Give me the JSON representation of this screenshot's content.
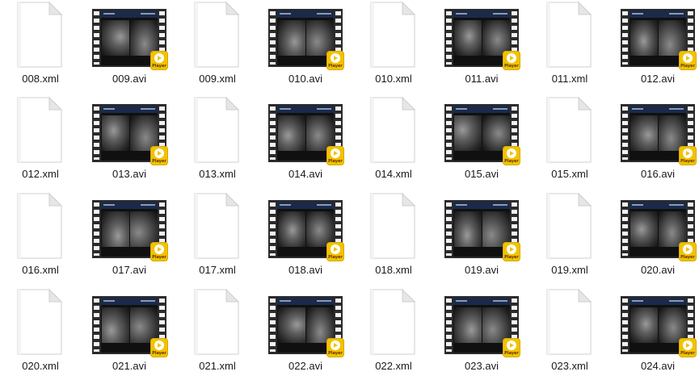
{
  "files": [
    {
      "name": "008.xml",
      "type": "xml"
    },
    {
      "name": "009.avi",
      "type": "avi"
    },
    {
      "name": "009.xml",
      "type": "xml"
    },
    {
      "name": "010.avi",
      "type": "avi"
    },
    {
      "name": "010.xml",
      "type": "xml"
    },
    {
      "name": "011.avi",
      "type": "avi"
    },
    {
      "name": "011.xml",
      "type": "xml"
    },
    {
      "name": "012.avi",
      "type": "avi"
    },
    {
      "name": "012.xml",
      "type": "xml"
    },
    {
      "name": "013.avi",
      "type": "avi"
    },
    {
      "name": "013.xml",
      "type": "xml"
    },
    {
      "name": "014.avi",
      "type": "avi"
    },
    {
      "name": "014.xml",
      "type": "xml"
    },
    {
      "name": "015.avi",
      "type": "avi"
    },
    {
      "name": "015.xml",
      "type": "xml"
    },
    {
      "name": "016.avi",
      "type": "avi"
    },
    {
      "name": "016.xml",
      "type": "xml"
    },
    {
      "name": "017.avi",
      "type": "avi"
    },
    {
      "name": "017.xml",
      "type": "xml"
    },
    {
      "name": "018.avi",
      "type": "avi"
    },
    {
      "name": "018.xml",
      "type": "xml"
    },
    {
      "name": "019.avi",
      "type": "avi"
    },
    {
      "name": "019.xml",
      "type": "xml"
    },
    {
      "name": "020.avi",
      "type": "avi"
    },
    {
      "name": "020.xml",
      "type": "xml"
    },
    {
      "name": "021.avi",
      "type": "avi"
    },
    {
      "name": "021.xml",
      "type": "xml"
    },
    {
      "name": "022.avi",
      "type": "avi"
    },
    {
      "name": "022.xml",
      "type": "xml"
    },
    {
      "name": "023.avi",
      "type": "avi"
    },
    {
      "name": "023.xml",
      "type": "xml"
    },
    {
      "name": "024.avi",
      "type": "avi"
    }
  ],
  "player_badge_label": "Player",
  "icons": {
    "xml": "blank-document-icon",
    "avi": "video-film-icon"
  },
  "colors": {
    "badge": "#f2c200",
    "film": "#2b2b2b",
    "scan_header": "#1b2a48"
  }
}
